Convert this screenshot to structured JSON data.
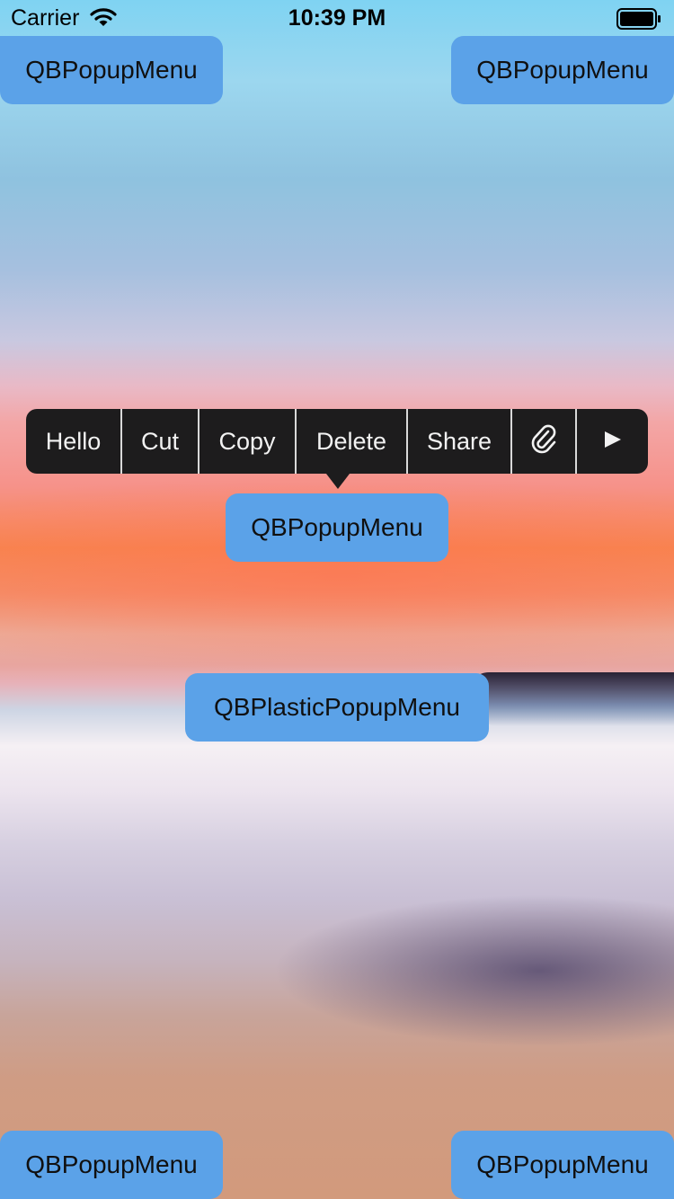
{
  "status_bar": {
    "carrier": "Carrier",
    "time": "10:39 PM"
  },
  "buttons": {
    "top_left": "QBPopupMenu",
    "top_right": "QBPopupMenu",
    "center": "QBPopupMenu",
    "plastic": "QBPlasticPopupMenu",
    "bottom_left": "QBPopupMenu",
    "bottom_right": "QBPopupMenu"
  },
  "popup_menu": {
    "items": [
      {
        "label": "Hello"
      },
      {
        "label": "Cut"
      },
      {
        "label": "Copy"
      },
      {
        "label": "Delete"
      },
      {
        "label": "Share"
      },
      {
        "icon": "paperclip-icon"
      },
      {
        "icon": "play-icon"
      }
    ]
  },
  "colors": {
    "button": "#5ba2e8",
    "popup_background": "#1d1c1d",
    "popup_separator": "#d9d9d9"
  }
}
